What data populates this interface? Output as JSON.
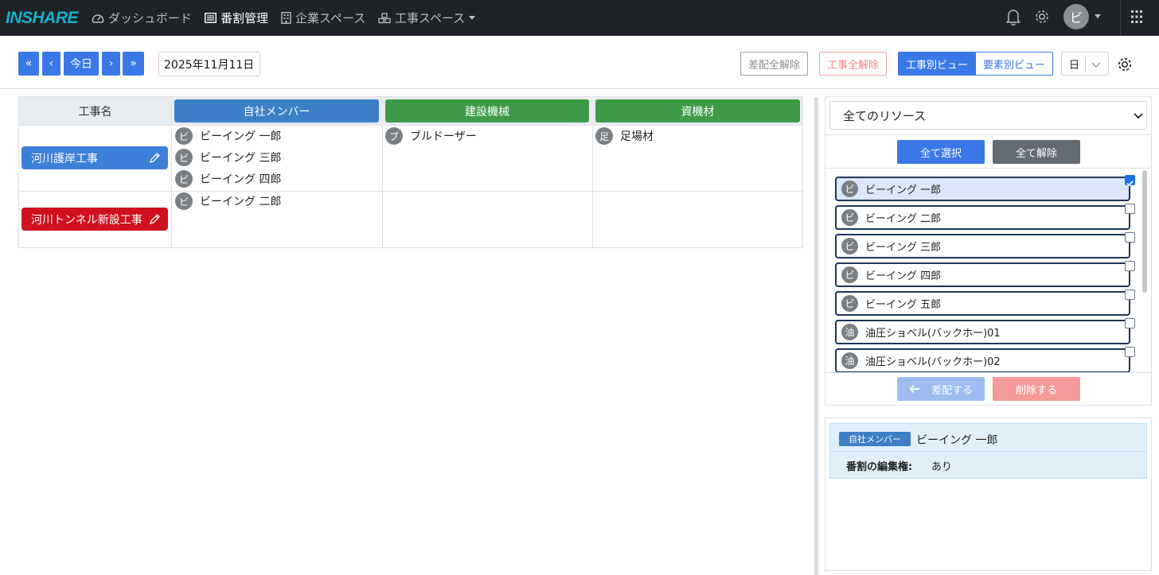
{
  "app": {
    "logo": "INSHARE"
  },
  "nav": [
    {
      "label": "ダッシュボード",
      "icon": "gauge-icon"
    },
    {
      "label": "番割管理",
      "icon": "list-icon"
    },
    {
      "label": "企業スペース",
      "icon": "building-icon"
    },
    {
      "label": "工事スペース",
      "icon": "cubes-icon"
    }
  ],
  "user": {
    "avatar": "ビ"
  },
  "toolbar": {
    "first": "«",
    "prev": "‹",
    "today": "今日",
    "next": "›",
    "last": "»",
    "date": "2025年11月11日",
    "clear_assign": "差配全解除",
    "clear_project": "工事全解除",
    "view_project": "工事別ビュー",
    "view_element": "要素別ビュー",
    "unit": "日"
  },
  "grid": {
    "name_header": "工事名",
    "columns": [
      {
        "label": "自社メンバー",
        "color": "#3d7fc6"
      },
      {
        "label": "建設機械",
        "color": "#3f9a48"
      },
      {
        "label": "資機材",
        "color": "#3f9a48"
      }
    ],
    "rows": [
      {
        "name": "河川護岸工事",
        "color": "#3d7fd8",
        "members": [
          {
            "badge": "ビ",
            "name": "ビーイング 一郎"
          },
          {
            "badge": "ビ",
            "name": "ビーイング 三郎"
          },
          {
            "badge": "ビ",
            "name": "ビーイング 四郎"
          }
        ],
        "machines": [
          {
            "badge": "ブ",
            "name": "ブルドーザー"
          }
        ],
        "materials": [
          {
            "badge": "足",
            "name": "足場材"
          }
        ]
      },
      {
        "name": "河川トンネル新設工事",
        "color": "#d0101e",
        "members": [
          {
            "badge": "ビ",
            "name": "ビーイング 二郎"
          }
        ],
        "machines": [],
        "materials": []
      }
    ]
  },
  "resources": {
    "filter": "全てのリソース",
    "select_all": "全て選択",
    "deselect_all": "全て解除",
    "items": [
      {
        "badge": "ビ",
        "name": "ビーイング 一郎",
        "checked": true
      },
      {
        "badge": "ビ",
        "name": "ビーイング 二郎",
        "checked": false
      },
      {
        "badge": "ビ",
        "name": "ビーイング 三郎",
        "checked": false
      },
      {
        "badge": "ビ",
        "name": "ビーイング 四郎",
        "checked": false
      },
      {
        "badge": "ビ",
        "name": "ビーイング 五郎",
        "checked": false
      },
      {
        "badge": "油",
        "name": "油圧ショベル(バックホー)01",
        "checked": false
      },
      {
        "badge": "油",
        "name": "油圧ショベル(バックホー)02",
        "checked": false
      }
    ],
    "assign": "差配する",
    "delete": "削除する"
  },
  "detail": {
    "tag": "自社メンバー",
    "name": "ビーイング 一郎",
    "perm_label": "番割の編集権:",
    "perm_value": "あり"
  }
}
